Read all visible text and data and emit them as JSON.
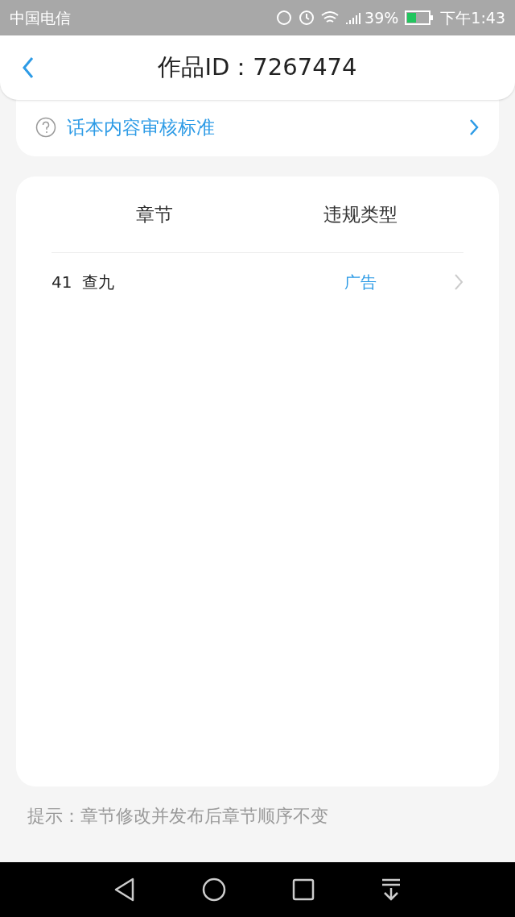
{
  "status_bar": {
    "carrier": "中国电信",
    "battery": "39%",
    "time": "下午1:43"
  },
  "header": {
    "title": "作品ID：7267474"
  },
  "standards_link": {
    "label": "话本内容审核标准"
  },
  "table": {
    "columns": [
      "章节",
      "违规类型"
    ],
    "rows": [
      {
        "chapter": "41  查九",
        "violation": "广告"
      }
    ]
  },
  "tip": "提示：章节修改并发布后章节顺序不变"
}
